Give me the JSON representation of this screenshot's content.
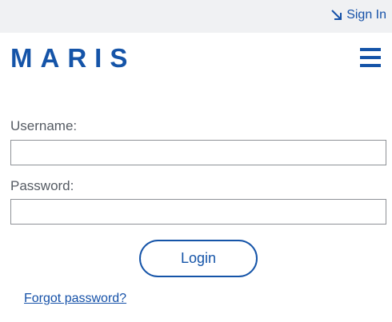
{
  "header": {
    "signin_label": "Sign In",
    "signin_icon": "sign-in-arrow-icon",
    "logo_text": "MARIS",
    "menu_icon": "hamburger-menu-icon"
  },
  "form": {
    "username_label": "Username:",
    "username_value": "",
    "password_label": "Password:",
    "password_value": "",
    "login_label": "Login",
    "forgot_label": "Forgot password?"
  },
  "colors": {
    "brand": "#1554a8",
    "topbar_bg": "#f0f1f3",
    "label_text": "#555b63"
  }
}
